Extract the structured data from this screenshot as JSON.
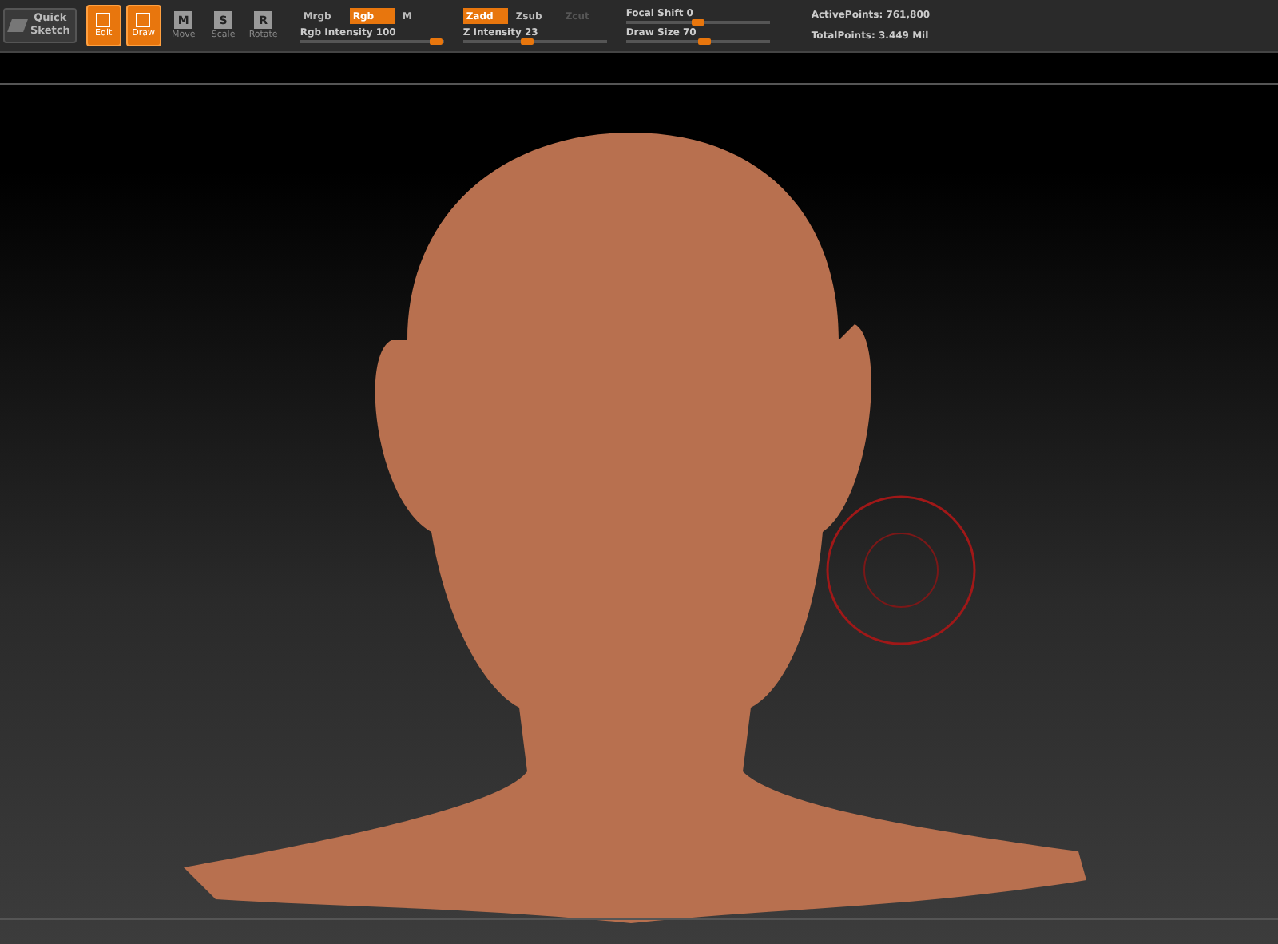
{
  "toolbar": {
    "quick_sketch": {
      "label": "Quick\nSketch",
      "selected": false
    },
    "modes": [
      {
        "label": "Edit",
        "selected": true
      },
      {
        "label": "Draw",
        "selected": true
      },
      {
        "label": "Move",
        "letter": "M",
        "selected": false
      },
      {
        "label": "Scale",
        "letter": "S",
        "selected": false
      },
      {
        "label": "Rotate",
        "letter": "R",
        "selected": false
      }
    ],
    "color_buttons": [
      {
        "label": "Mrgb",
        "selected": false
      },
      {
        "label": "Rgb",
        "selected": true
      },
      {
        "label": "M",
        "selected": false
      }
    ],
    "rgb_slider": {
      "label": "Rgb Intensity",
      "value": "100",
      "level": 0.95
    },
    "z_buttons": [
      {
        "label": "Zadd",
        "selected": true,
        "disabled": false
      },
      {
        "label": "Zsub",
        "selected": false,
        "disabled": false
      },
      {
        "label": "Zcut",
        "selected": false,
        "disabled": true
      }
    ],
    "z_slider": {
      "label": "Z Intensity",
      "value": "23",
      "level": 0.45
    },
    "brush_sliders": [
      {
        "label": "Focal Shift",
        "value": "0",
        "level": 0.5
      },
      {
        "label": "Draw Size",
        "value": "70",
        "level": 0.55
      }
    ],
    "stats": [
      "ActivePoints: 761,800",
      "TotalPoints: 3.449 Mil"
    ]
  },
  "viewport": {
    "brush_cursor": true
  }
}
